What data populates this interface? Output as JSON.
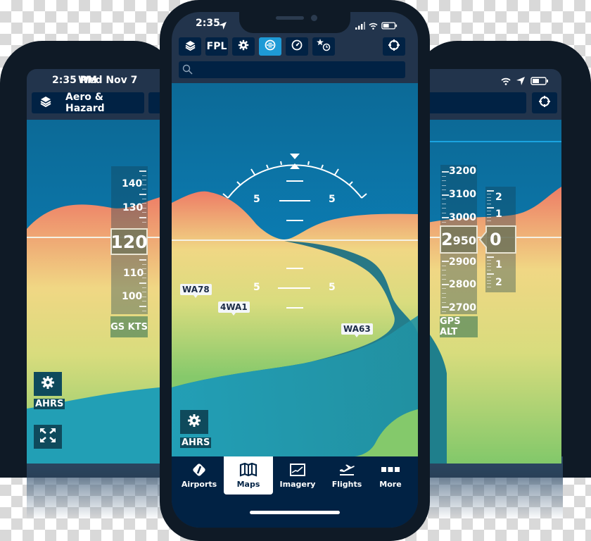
{
  "left_tablet": {
    "status": {
      "time": "2:35 PM",
      "date": "Wed Nov 7"
    },
    "layer_button": {
      "icon": "layers-icon",
      "label": "Aero & Hazard"
    },
    "airspeed_tape": {
      "labels": [
        "140",
        "130",
        "110",
        "100"
      ],
      "current": "120",
      "caption": "GS KTS"
    },
    "ahrs_label": "AHRS",
    "expand_icon": "expand-icon"
  },
  "right_tablet": {
    "status_icons": [
      "wifi-icon",
      "location-arrow-icon",
      "battery-icon"
    ],
    "center_button_icon": "crosshair-icon",
    "altitude_tape": {
      "labels": [
        "3200",
        "3100",
        "3000",
        "2900",
        "2800",
        "2700"
      ],
      "current_big": "2",
      "current_small": "950",
      "caption": "GPS ALT"
    },
    "vsi_tape": {
      "labels_up": [
        "2",
        "1"
      ],
      "current": "0",
      "labels_down": [
        "1",
        "2"
      ]
    }
  },
  "phone": {
    "status": {
      "time": "2:35",
      "icons": [
        "location-arrow-icon",
        "signal-icon",
        "wifi-icon",
        "battery-icon"
      ]
    },
    "toolbar": {
      "layers_icon": "layers-icon",
      "fpl_label": "FPL",
      "settings_icon": "gear-icon",
      "synthetic_vision_icon": "attitude-icon",
      "instruments_icon": "gauge-icon",
      "favorites_recent_icon": "star-clock-icon",
      "center_icon": "crosshair-icon"
    },
    "search": {
      "placeholder": "",
      "value": ""
    },
    "pfd": {
      "pitch_labels": [
        "5",
        "5",
        "5",
        "5"
      ],
      "airports": [
        "WA78",
        "4WA1",
        "WA63"
      ],
      "ahrs_label": "AHRS"
    },
    "tabs": [
      {
        "label": "Airports",
        "icon": "airport-icon",
        "active": false
      },
      {
        "label": "Maps",
        "icon": "map-icon",
        "active": true
      },
      {
        "label": "Imagery",
        "icon": "imagery-icon",
        "active": false
      },
      {
        "label": "Flights",
        "icon": "plane-departure-icon",
        "active": false
      },
      {
        "label": "More",
        "icon": "more-icon",
        "active": false
      }
    ]
  },
  "colors": {
    "device_frame": "#0f1a26",
    "nav_dark": "#012244",
    "active_blue": "#1e9ad6",
    "sky": "#0a86bf",
    "terrain_red": "#ee7d66",
    "terrain_yellow": "#f0da84",
    "grass": "#84c96b",
    "water": "#229fb5"
  }
}
